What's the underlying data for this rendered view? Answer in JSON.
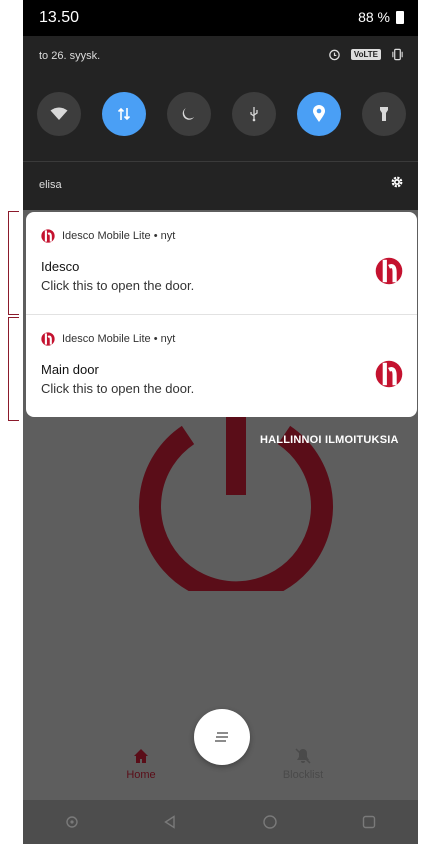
{
  "status_bar": {
    "time": "13.50",
    "battery": "88 %"
  },
  "shade": {
    "date": "to 26. syysk.",
    "volte": "VoLTE",
    "carrier": "elisa"
  },
  "quick_settings": [
    {
      "name": "wifi",
      "on": false
    },
    {
      "name": "mobile-data",
      "on": true
    },
    {
      "name": "do-not-disturb",
      "on": false
    },
    {
      "name": "usb",
      "on": false
    },
    {
      "name": "location",
      "on": true
    },
    {
      "name": "flashlight",
      "on": false
    }
  ],
  "notifications": [
    {
      "app": "Idesco Mobile Lite",
      "time": "nyt",
      "title": "Idesco",
      "body": "Click this to open the door."
    },
    {
      "app": "Idesco Mobile Lite",
      "time": "nyt",
      "title": "Main door",
      "body": "Click this to open the door."
    }
  ],
  "manage_label": "HALLINNOI ILMOITUKSIA",
  "bottom_nav": {
    "home": "Home",
    "blocklist": "Blocklist"
  },
  "colors": {
    "brand": "#c4122f",
    "accent_dark": "#5a0d18",
    "quick_on": "#4a9ff5"
  }
}
